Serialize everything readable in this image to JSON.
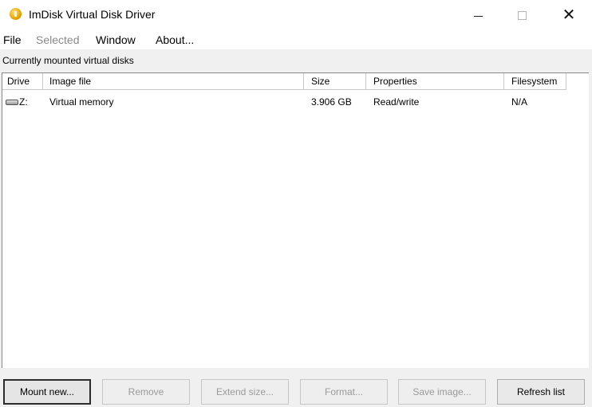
{
  "window": {
    "title": "ImDisk Virtual Disk Driver"
  },
  "menu": {
    "file": "File",
    "selected": "Selected",
    "window": "Window",
    "about": "About..."
  },
  "section_label": "Currently mounted virtual disks",
  "columns": {
    "drive": "Drive",
    "image_file": "Image file",
    "size": "Size",
    "properties": "Properties",
    "filesystem": "Filesystem"
  },
  "rows": [
    {
      "drive": "Z:",
      "image_file": "Virtual memory",
      "size": "3.906 GB",
      "properties": "Read/write",
      "filesystem": "N/A"
    }
  ],
  "buttons": {
    "mount_new": "Mount new...",
    "remove": "Remove",
    "extend_size": "Extend size...",
    "format": "Format...",
    "save_image": "Save image...",
    "refresh_list": "Refresh list"
  },
  "icons": {
    "app": "imdisk-app-icon",
    "drive": "drive-icon"
  },
  "colors": {
    "background": "#f0f0f0",
    "titlebar": "#ffffff",
    "disabled_text": "#8a8a8a"
  }
}
